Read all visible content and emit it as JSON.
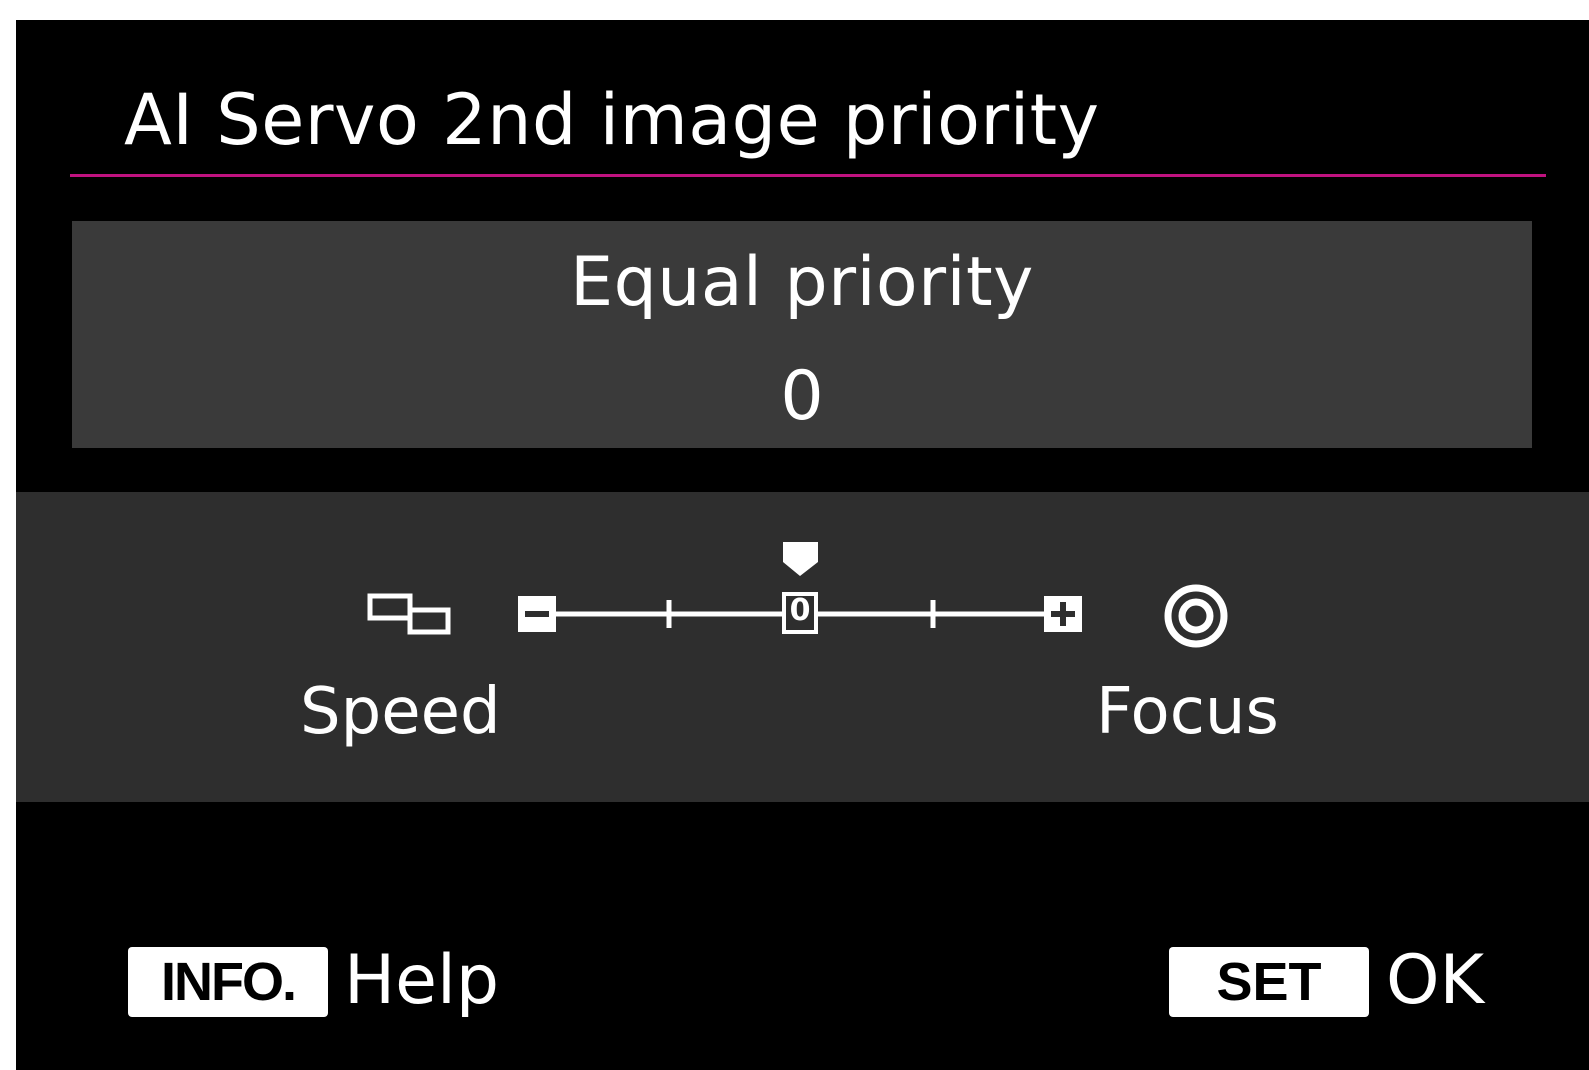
{
  "title": "AI Servo 2nd image priority",
  "current": {
    "label": "Equal priority",
    "value": "0"
  },
  "scale": {
    "min_label": "Speed",
    "max_label": "Focus",
    "zero_mark": "0",
    "range": [
      -2,
      2
    ],
    "selected": 0,
    "left_icon": "continuous-shooting-icon",
    "right_icon": "focus-icon",
    "minus_symbol": "minus-icon",
    "plus_symbol": "plus-icon"
  },
  "footer": {
    "info_button": "INFO.",
    "info_action": "Help",
    "set_button": "SET",
    "set_action": "OK"
  },
  "colors": {
    "accent_rule": "#c0127f",
    "value_box": "#3a3a3a",
    "scale_band": "#2e2e2e"
  }
}
